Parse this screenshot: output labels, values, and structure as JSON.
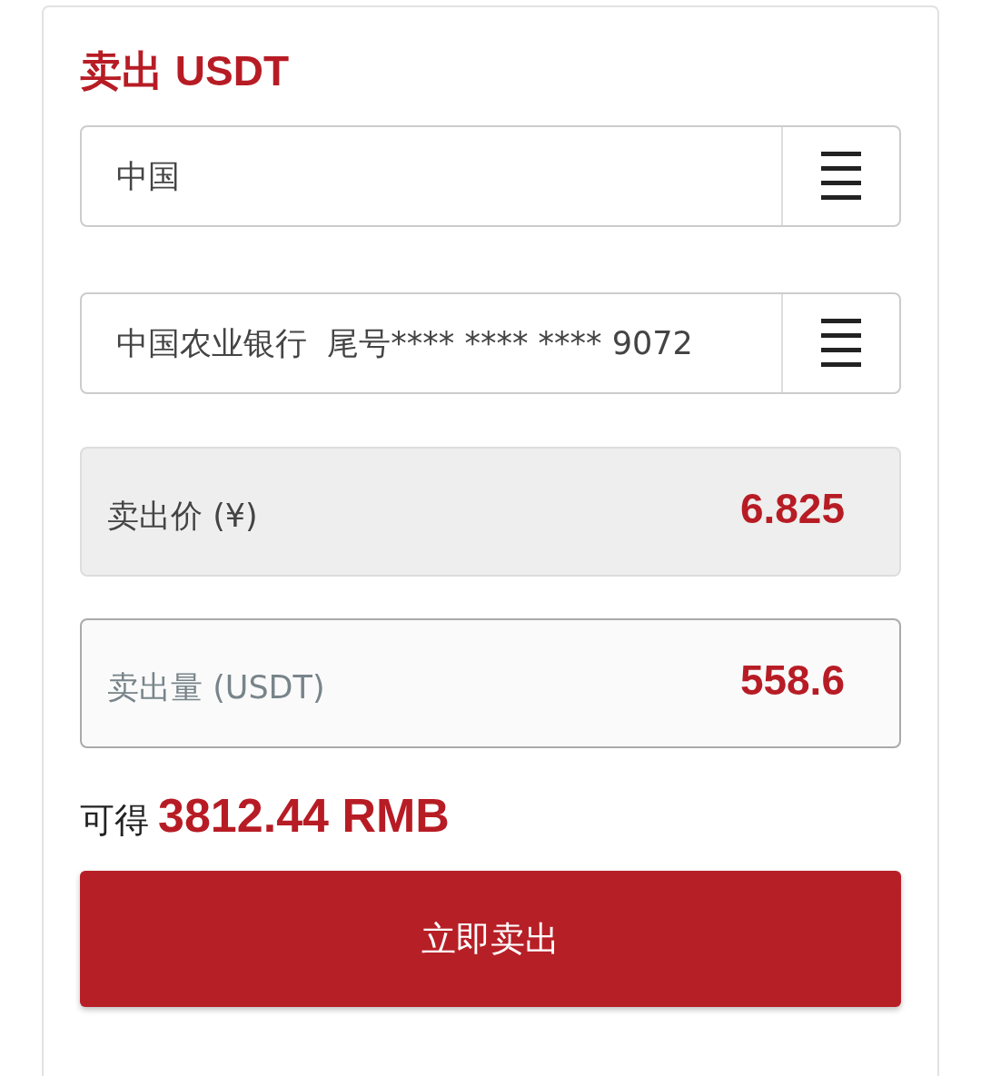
{
  "title": "卖出 USDT",
  "country_select": {
    "value": "中国"
  },
  "account_select": {
    "value": "中国农业银行  尾号**** **** **** 9072"
  },
  "price": {
    "label": "卖出价 (¥)",
    "value": "6.825"
  },
  "amount": {
    "label": "卖出量 (USDT)",
    "value": "558.6"
  },
  "payout": {
    "label": "可得",
    "value": "3812.44 RMB"
  },
  "submit_button": "立即卖出"
}
